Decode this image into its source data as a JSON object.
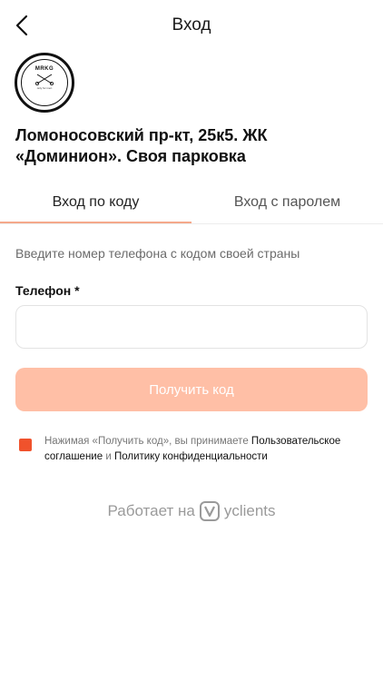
{
  "header": {
    "title": "Вход"
  },
  "logo": {
    "text": "MRKG",
    "subtext": "only for men"
  },
  "salon": {
    "name": "Ломоносовский пр-кт, 25к5. ЖК «Доминион». Своя парковка"
  },
  "tabs": [
    {
      "label": "Вход по коду",
      "active": true
    },
    {
      "label": "Вход с паролем",
      "active": false
    }
  ],
  "form": {
    "hint": "Введите номер телефона с кодом своей страны",
    "phone_label": "Телефон *",
    "phone_value": "",
    "submit_label": "Получить код"
  },
  "consent": {
    "prefix": "Нажимая «Получить код», вы принимаете ",
    "link1": "Пользовательское соглашение",
    "middle": " и ",
    "link2": "Политику конфиденциальности",
    "checked": true
  },
  "footer": {
    "powered_prefix": "Работает на",
    "brand": "yclients"
  },
  "colors": {
    "accent": "#f0522c",
    "button_disabled": "#ffbfa6",
    "tab_underline": "#f5a98b"
  },
  "icons": {
    "back": "chevron-left-icon",
    "brand": "yclients-logo-icon"
  }
}
